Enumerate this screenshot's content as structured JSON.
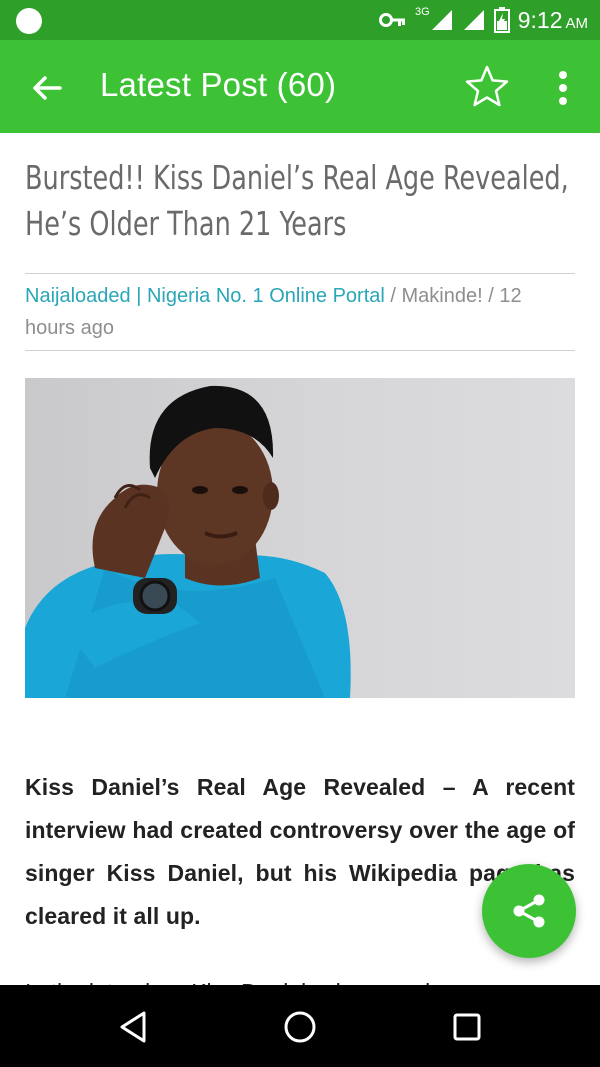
{
  "status_bar": {
    "network_label": "3G",
    "time": "9:12",
    "ampm": "AM"
  },
  "app_bar": {
    "title": "Latest Post (60)",
    "icons": [
      "arrow-back-icon",
      "star-outline-icon",
      "more-vert-icon"
    ]
  },
  "post": {
    "title": "Bursted!! Kiss Daniel’s Real Age Revealed, He’s Older Than 21 Years",
    "source": "Naijaloaded | Nigeria No. 1 Online Portal",
    "separator_1": " / ",
    "author": "Makinde!",
    "separator_2": " / ",
    "time_ago": "12 hours ago",
    "body_intro": "Kiss Daniel’s Real Age Revealed – A recent interview had created controversy over the age of singer Kiss Daniel, but his Wikipedia page has cleared it all up.",
    "body_next": "In the interview, Kiss Daniel, whose real name"
  },
  "fab": {
    "icon": "share-icon"
  },
  "nav_bar": {
    "icons": [
      "back-triangle-icon",
      "home-circle-icon",
      "recents-square-icon"
    ]
  },
  "colors": {
    "status_bar": "#2ea02a",
    "app_bar": "#3cc234",
    "title_text": "#6a6a6a",
    "source_link": "#29a6b8",
    "meta_text": "#8e8e8e",
    "body_text": "#222222"
  }
}
